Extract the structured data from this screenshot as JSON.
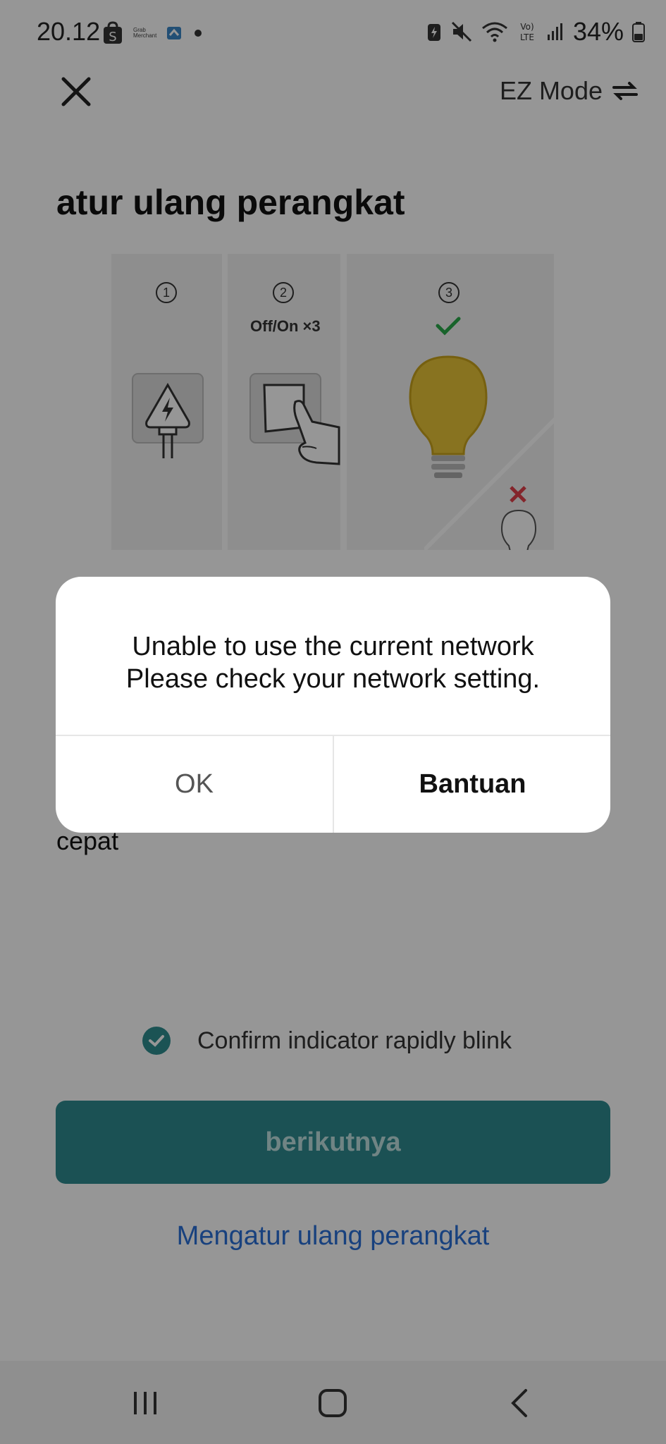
{
  "status_bar": {
    "time": "20.12",
    "battery": "34%",
    "grab_text": "Grab Merchant"
  },
  "header": {
    "mode_label": "EZ Mode"
  },
  "page": {
    "title": "atur ulang perangkat",
    "illustration": {
      "steps": [
        "1",
        "2",
        "3"
      ],
      "step2_caption": "Off/On ×3"
    },
    "body_text": "cepat",
    "confirm_label": "Confirm indicator rapidly blink",
    "confirm_checked": true,
    "next_button": "berikutnya",
    "reset_link": "Mengatur ulang perangkat"
  },
  "dialog": {
    "message_line1": "Unable to use the current network",
    "message_line2": "Please check your network setting.",
    "ok_button": "OK",
    "help_button": "Bantuan"
  },
  "colors": {
    "accent": "#2e8b90",
    "link": "#2a6fd6",
    "check_green": "#2aa84a",
    "cross_red": "#e0404a",
    "bulb_yellow": "#e8c437"
  },
  "icons": {
    "close": "close-icon",
    "switch_mode": "swap-arrows-icon",
    "nav": [
      "recent-apps-icon",
      "home-icon",
      "back-icon"
    ]
  }
}
